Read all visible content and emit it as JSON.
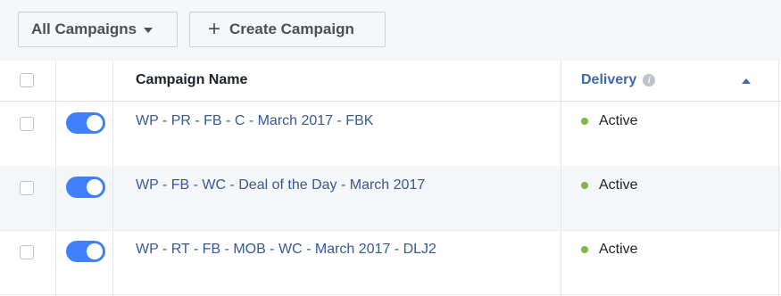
{
  "toolbar": {
    "campaign_filter_label": "All Campaigns",
    "create_label": "Create Campaign"
  },
  "table": {
    "columns": {
      "name": "Campaign Name",
      "delivery": "Delivery"
    },
    "sort": {
      "column": "delivery",
      "direction": "ascending"
    },
    "rows": [
      {
        "name": "WP - PR - FB - C - March 2017 - FBK",
        "status": "Active",
        "toggle_on": true,
        "selected": false
      },
      {
        "name": "WP - FB - WC - Deal of the Day - March 2017",
        "status": "Active",
        "toggle_on": true,
        "selected": false
      },
      {
        "name": "WP - RT - FB - MOB - WC - March 2017 - DLJ2",
        "status": "Active",
        "toggle_on": true,
        "selected": false
      }
    ]
  },
  "colors": {
    "accent": "#4080ff",
    "link": "#365899",
    "active_status": "#7fb549"
  },
  "icons": {
    "dropdown": "caret-down-icon",
    "create": "plus-icon",
    "info": "info-icon",
    "sort": "sort-ascending-icon"
  }
}
